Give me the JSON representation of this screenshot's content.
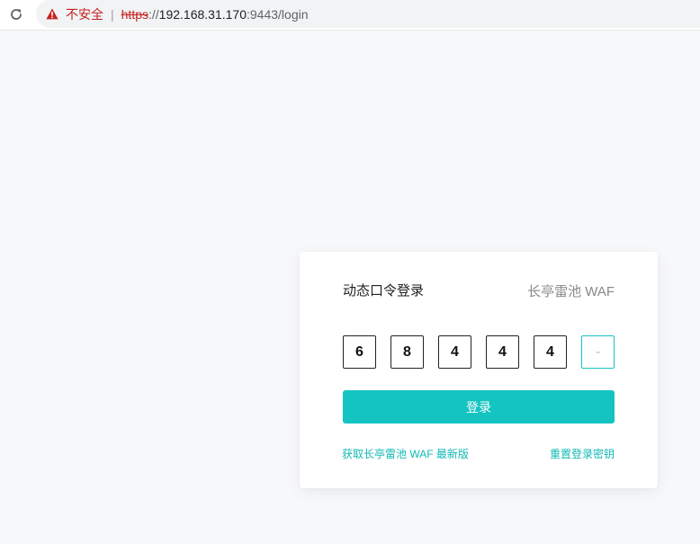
{
  "browser": {
    "insecure_label": "不安全",
    "url_scheme": "https",
    "url_sep": "://",
    "url_host": "192.168.31.170",
    "url_path": ":9443/login",
    "icons": {
      "reload": "reload-icon",
      "warning": "warning-triangle-icon"
    },
    "warning_color": "#c5221f"
  },
  "login": {
    "title": "动态口令登录",
    "brand": "长亭雷池 WAF",
    "otp_digits": [
      "6",
      "8",
      "4",
      "4",
      "4",
      "-"
    ],
    "submit_label": "登录",
    "link_download": "获取长亭雷池 WAF 最新版",
    "link_reset": "重置登录密钥"
  },
  "colors": {
    "accent": "#13c4c1",
    "page_background": "#f7f8fa"
  }
}
